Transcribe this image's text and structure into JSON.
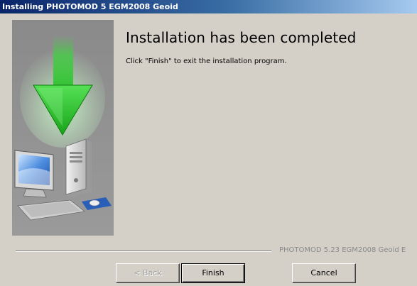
{
  "window": {
    "title": "Installing PHOTOMOD 5 EGM2008 Geoid"
  },
  "main": {
    "heading": "Installation has been completed",
    "description": "Click \"Finish\" to exit the installation program."
  },
  "footer": {
    "brand": "PHOTOMOD 5.23 EGM2008 Geoid E"
  },
  "buttons": {
    "back": "< Back",
    "finish": "Finish",
    "cancel": "Cancel"
  },
  "banner": {
    "arrow_icon": "download-arrow-icon",
    "computer_icon": "computer-icon"
  },
  "colors": {
    "titlebar_start": "#0a246a",
    "titlebar_end": "#a6caf0",
    "dialog_bg": "#d4d0c8",
    "banner_bg": "#8c8c8c",
    "arrow_green": "#3cd43c"
  }
}
